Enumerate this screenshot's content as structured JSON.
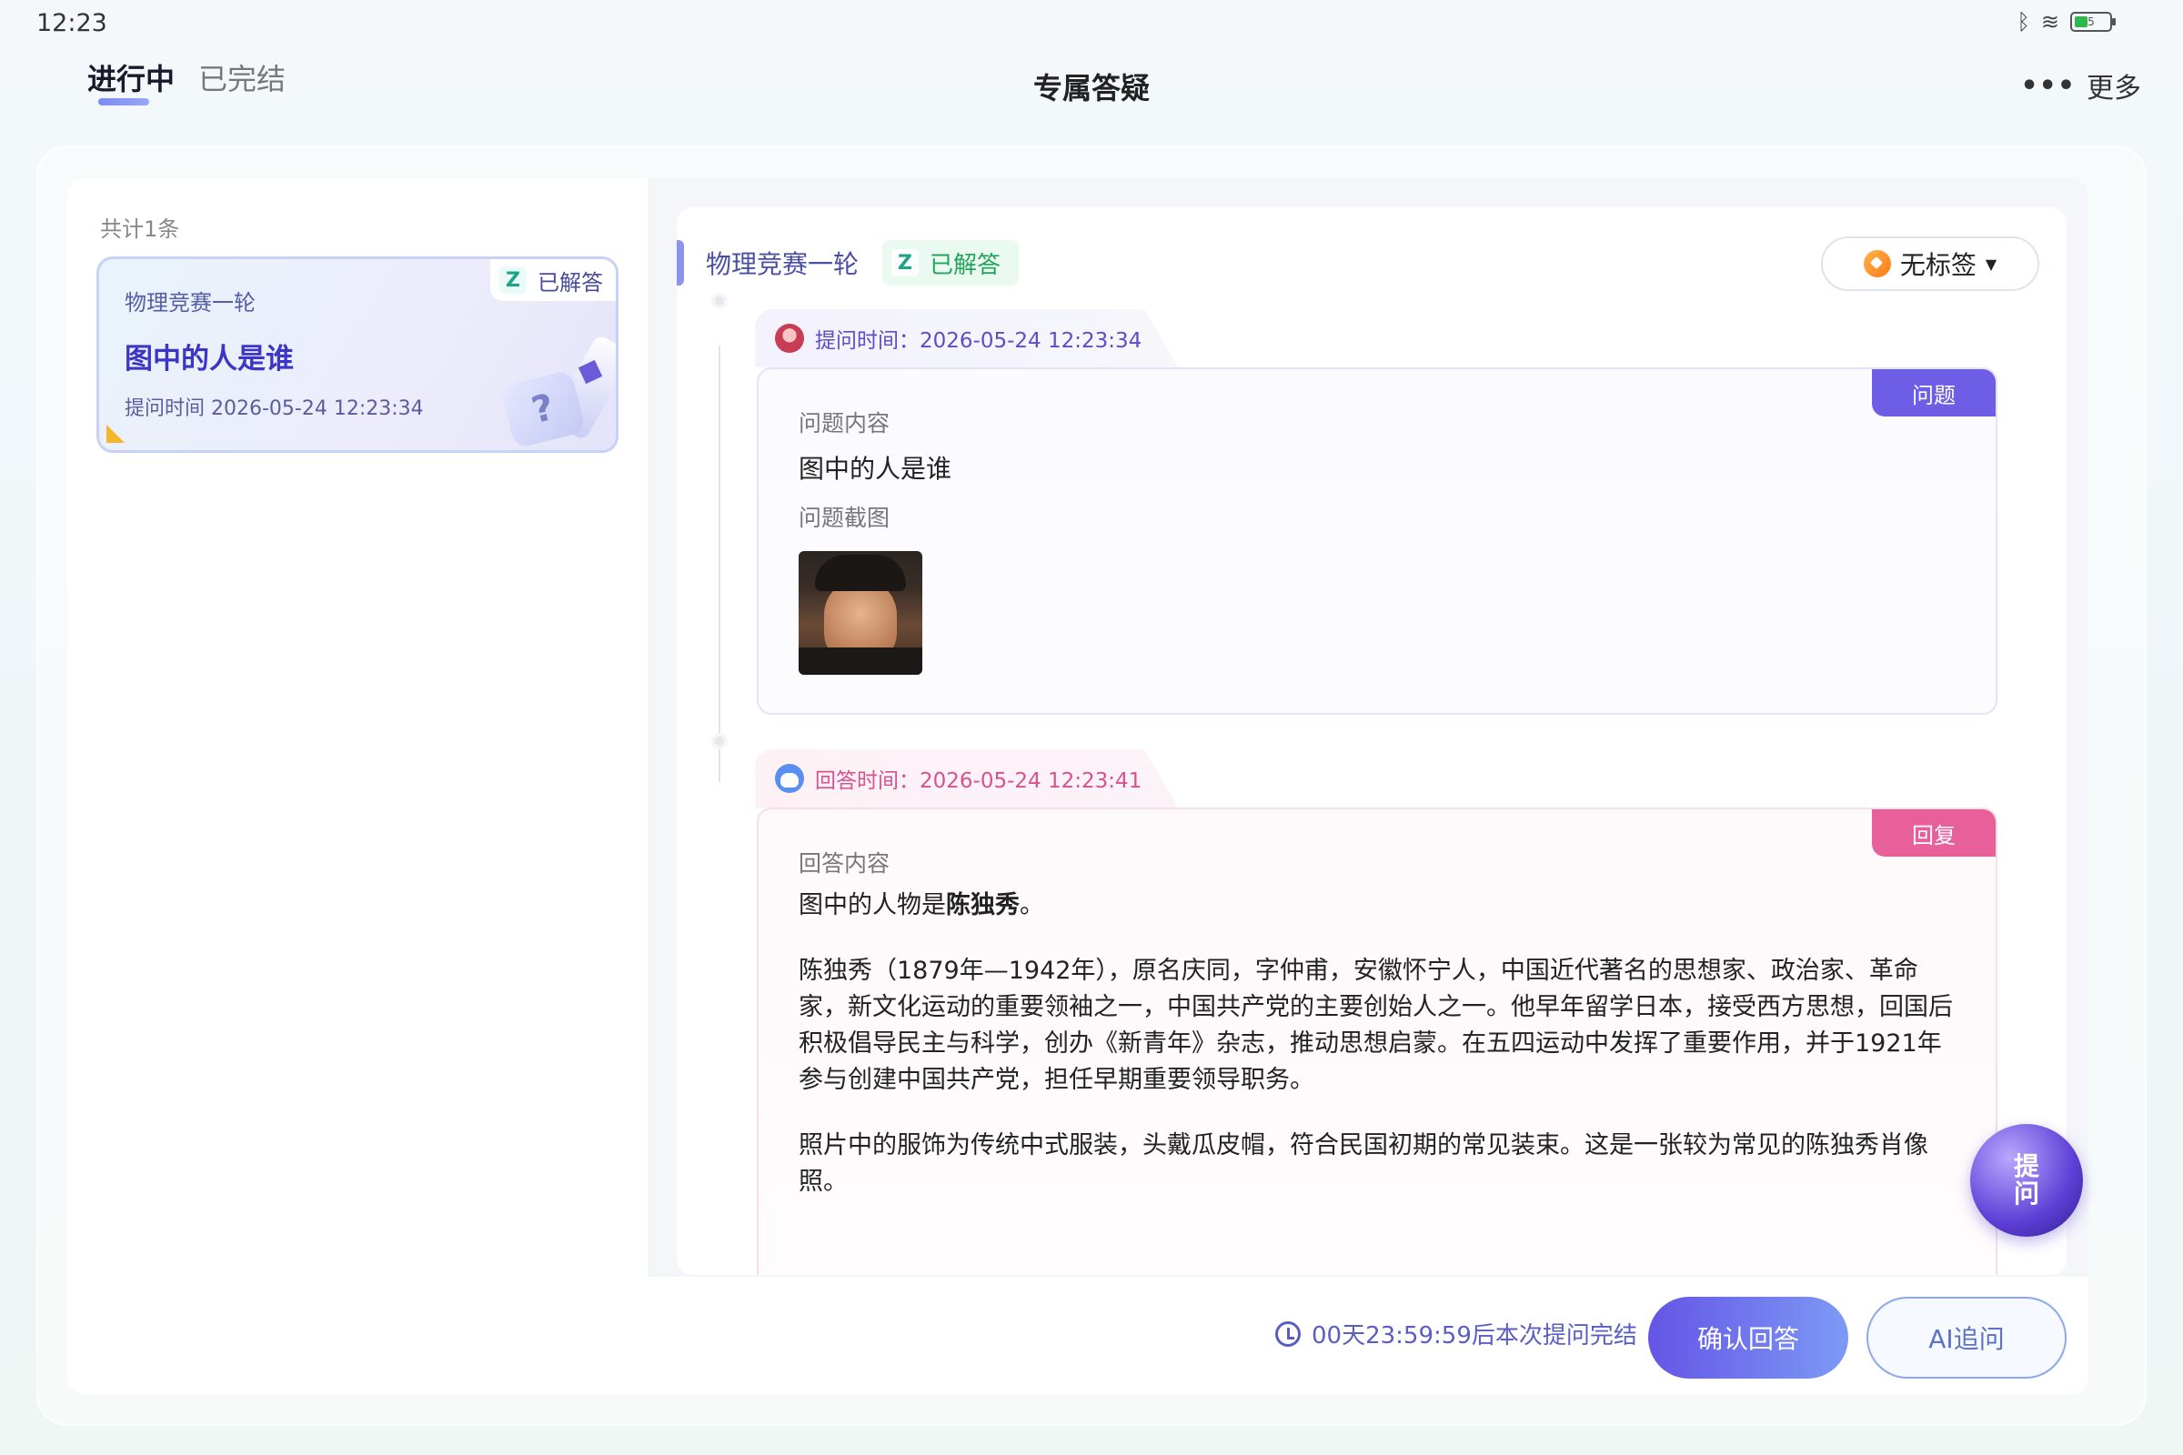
{
  "status_bar": {
    "time": "12:23",
    "battery_level": "5"
  },
  "header": {
    "tabs": [
      {
        "label": "进行中",
        "active": true
      },
      {
        "label": "已完结",
        "active": false
      }
    ],
    "title": "专属答疑",
    "more_label": "更多"
  },
  "list": {
    "count_text": "共计1条",
    "items": [
      {
        "subject": "物理竞赛一轮",
        "status": "已解答",
        "title": "图中的人是谁",
        "time": "提问时间 2026-05-24 12:23:34"
      }
    ]
  },
  "detail": {
    "subject": "物理竞赛一轮",
    "status": "已解答",
    "tag_label": "无标签",
    "question": {
      "time_label": "提问时间：2026-05-24 12:23:34",
      "corner_label": "问题",
      "content_label": "问题内容",
      "content": "图中的人是谁",
      "screenshot_label": "问题截图"
    },
    "answer": {
      "time_label": "回答时间：2026-05-24 12:23:41",
      "corner_label": "回复",
      "content_label": "回答内容",
      "lead": "图中的人物是",
      "lead_name": "陈独秀",
      "lead_end": "。",
      "paragraph1": "陈独秀（1879年—1942年），原名庆同，字仲甫，安徽怀宁人，中国近代著名的思想家、政治家、革命家，新文化运动的重要领袖之一，中国共产党的主要创始人之一。他早年留学日本，接受西方思想，回国后积极倡导民主与科学，创办《新青年》杂志，推动思想启蒙。在五四运动中发挥了重要作用，并于1921年参与创建中国共产党，担任早期重要领导职务。",
      "paragraph2": "照片中的服饰为传统中式服装，头戴瓜皮帽，符合民国初期的常见装束。这是一张较为常见的陈独秀肖像照。"
    }
  },
  "float_button": {
    "line1": "提",
    "line2": "问"
  },
  "footer": {
    "countdown": "00天23:59:59后本次提问完结",
    "confirm_label": "确认回答",
    "ai_label": "AI追问"
  }
}
